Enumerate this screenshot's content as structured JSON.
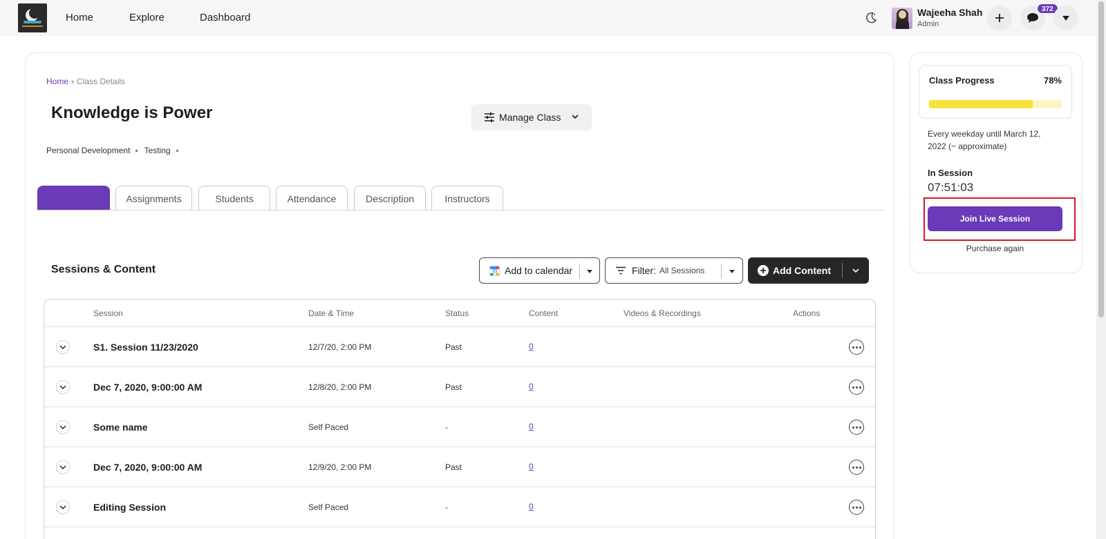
{
  "topbar": {
    "nav": [
      "Home",
      "Explore",
      "Dashboard"
    ],
    "user_name": "Wajeeha Shah",
    "user_role": "Admin",
    "notifications": "372"
  },
  "breadcrumb": {
    "home": "Home",
    "current": "Class Details"
  },
  "class": {
    "title": "Knowledge is Power",
    "manage_label": "Manage Class",
    "tags": [
      "Personal Development",
      "Testing"
    ]
  },
  "tabs": [
    "",
    "Assignments",
    "Students",
    "Attendance",
    "Description",
    "Instructors"
  ],
  "sessions": {
    "title": "Sessions & Content",
    "add_calendar": "Add to calendar",
    "filter_label": "Filter:",
    "filter_value": "All Sessions",
    "add_content": "Add Content",
    "columns": [
      "Session",
      "Date & Time",
      "Status",
      "Content",
      "Videos & Recordings",
      "Actions"
    ],
    "rows": [
      {
        "name": "S1. Session 11/23/2020",
        "datetime": "12/7/20, 2:00 PM",
        "status": "Past",
        "content": "0"
      },
      {
        "name": "Dec 7, 2020, 9:00:00 AM",
        "datetime": "12/8/20, 2:00 PM",
        "status": "Past",
        "content": "0"
      },
      {
        "name": "Some name",
        "datetime": "Self Paced",
        "status": "-",
        "content": "0"
      },
      {
        "name": "Dec 7, 2020, 9:00:00 AM",
        "datetime": "12/9/20, 2:00 PM",
        "status": "Past",
        "content": "0"
      },
      {
        "name": "Editing Session",
        "datetime": "Self Paced",
        "status": "-",
        "content": "0"
      }
    ]
  },
  "progress": {
    "label": "Class Progress",
    "percent_text": "78%",
    "percent": 78,
    "schedule": "Every weekday until March 12, 2022 (~ approximate)",
    "in_session": "In Session",
    "timer": "07:51:03",
    "join_label": "Join Live Session",
    "purchase_again": "Purchase again"
  },
  "colors": {
    "accent": "#6a3ab8",
    "progress": "#f8e13a",
    "highlight": "#d9171f"
  }
}
